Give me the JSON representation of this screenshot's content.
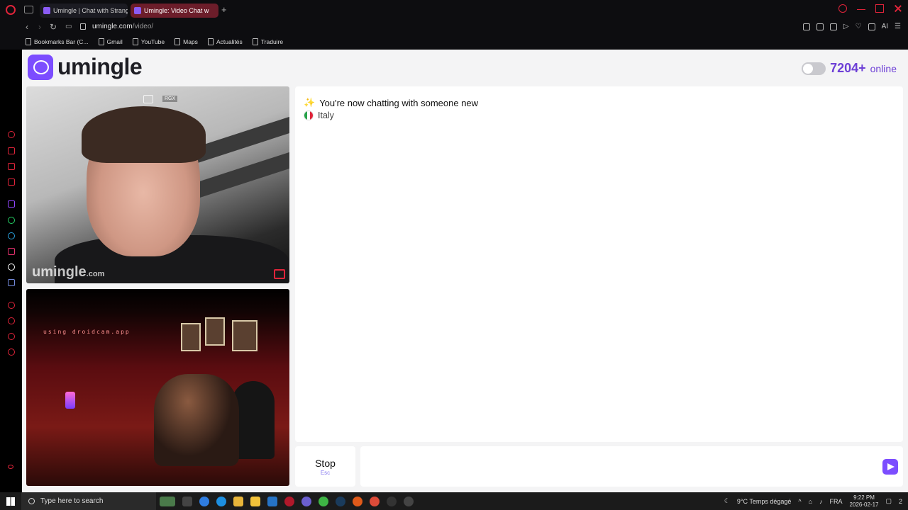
{
  "browser": {
    "tabs": [
      {
        "label": "Umingle | Chat with Strang",
        "active": false
      },
      {
        "label": "Umingle: Video Chat w",
        "active": true
      }
    ],
    "new_tab": "+",
    "url_host": "umingle.com",
    "url_path": "/video/",
    "ai_label": "AI",
    "bookmarks": [
      "Bookmarks Bar (C...",
      "Gmail",
      "YouTube",
      "Maps",
      "Actualités",
      "Traduire"
    ]
  },
  "site": {
    "logo_text": "umingle",
    "online_count": "7204+",
    "online_label": "online",
    "accent_color": "#7c4dff"
  },
  "video": {
    "watermark": "umingle",
    "watermark_suffix": ".com",
    "rgx_label": "RGX",
    "self_overlay_text": "using droidcam.app"
  },
  "chat": {
    "system_message": "You're now chatting with someone new",
    "country": "Italy"
  },
  "controls": {
    "stop_label": "Stop",
    "stop_hint": "Esc",
    "message_value": ""
  },
  "taskbar": {
    "search_placeholder": "Type here to search",
    "weather": "9°C  Temps dégagé",
    "language": "FRA",
    "time": "9:22 PM",
    "date": "2026-02-17",
    "notifications": "2"
  }
}
